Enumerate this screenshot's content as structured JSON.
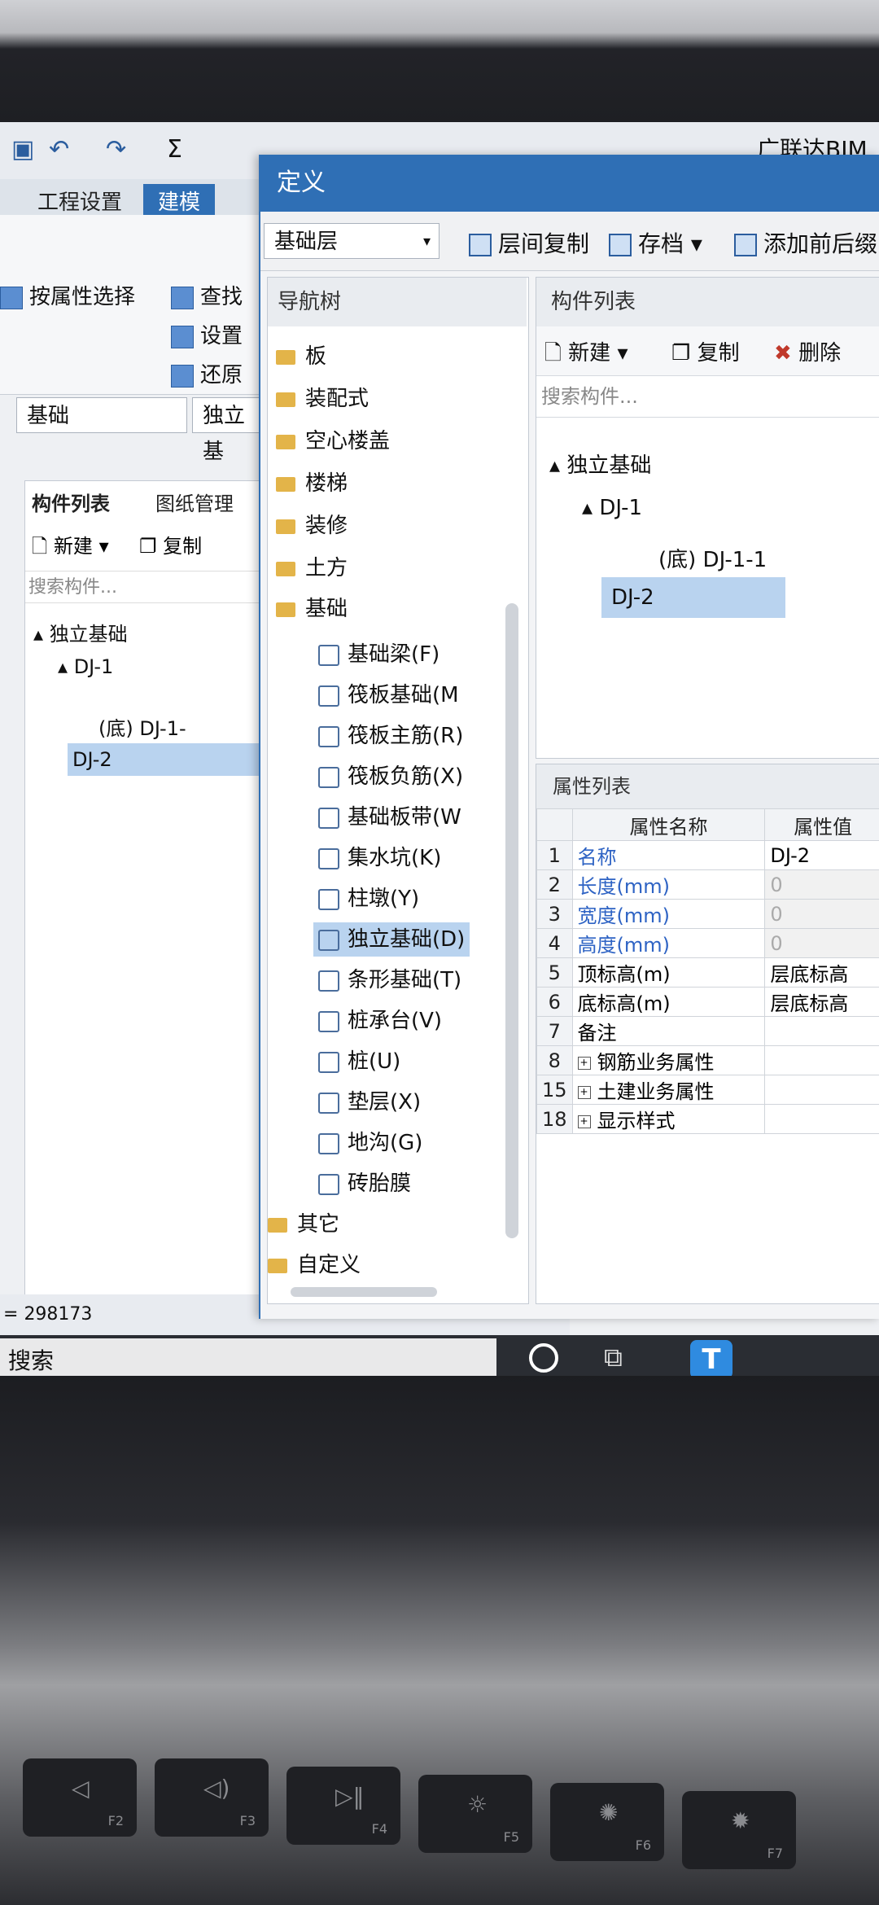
{
  "app": {
    "toolbar": {
      "title_partial": "广联达BIM"
    },
    "ribbon_tabs": [
      {
        "label": "工程设置"
      },
      {
        "label": "建模"
      }
    ],
    "ribbon": {
      "select_by_attr": "按属性选择",
      "find": "查找",
      "set": "设置",
      "restore": "还原"
    },
    "combo_floor": "基础",
    "combo_type": "独立基",
    "left_panel": {
      "tabs": [
        {
          "label": "构件列表"
        },
        {
          "label": "图纸管理"
        }
      ],
      "new_label": "新建",
      "copy_label": "复制",
      "search_placeholder": "搜索构件...",
      "tree": [
        {
          "label": "独立基础"
        },
        {
          "label": "DJ-1"
        },
        {
          "label": "(底) DJ-1-"
        },
        {
          "label": "DJ-2"
        }
      ]
    },
    "status_number": "298173",
    "taskbar": {
      "search_label": "搜索"
    }
  },
  "dialog": {
    "title": "定义",
    "floor_select": "基础层",
    "tools": {
      "copy_between_floors": "层间复制",
      "archive": "存档",
      "add_before": "添加前后缀"
    },
    "nav": {
      "header": "导航树",
      "folders": [
        {
          "label": "板"
        },
        {
          "label": "装配式"
        },
        {
          "label": "空心楼盖"
        },
        {
          "label": "楼梯"
        },
        {
          "label": "装修"
        },
        {
          "label": "土方"
        },
        {
          "label": "基础"
        }
      ],
      "children": [
        {
          "label": "基础梁(F)",
          "icon": "beam-icon"
        },
        {
          "label": "筏板基础(M",
          "icon": "raft-icon"
        },
        {
          "label": "筏板主筋(R)",
          "icon": "main-rebar-icon"
        },
        {
          "label": "筏板负筋(X)",
          "icon": "neg-rebar-icon"
        },
        {
          "label": "基础板带(W",
          "icon": "strip-icon"
        },
        {
          "label": "集水坑(K)",
          "icon": "sump-icon"
        },
        {
          "label": "柱墩(Y)",
          "icon": "pier-icon"
        },
        {
          "label": "独立基础(D)",
          "icon": "isolated-footing-icon"
        },
        {
          "label": "条形基础(T)",
          "icon": "strip-footing-icon"
        },
        {
          "label": "桩承台(V)",
          "icon": "pile-cap-icon"
        },
        {
          "label": "桩(U)",
          "icon": "pile-icon"
        },
        {
          "label": "垫层(X)",
          "icon": "cushion-icon"
        },
        {
          "label": "地沟(G)",
          "icon": "trench-icon"
        },
        {
          "label": "砖胎膜",
          "icon": "brick-mold-icon"
        }
      ],
      "tail_folders": [
        {
          "label": "其它"
        },
        {
          "label": "自定义"
        }
      ]
    },
    "component_list": {
      "header": "构件列表",
      "new_label": "新建",
      "copy_label": "复制",
      "delete_label": "删除",
      "search_placeholder": "搜索构件...",
      "tree": [
        {
          "label": "独立基础"
        },
        {
          "label": "DJ-1"
        },
        {
          "label": "(底) DJ-1-1"
        },
        {
          "label": "DJ-2"
        }
      ]
    },
    "properties": {
      "header": "属性列表",
      "col_name": "属性名称",
      "col_value": "属性值",
      "rows": [
        {
          "num": "1",
          "name": "名称",
          "value": "DJ-2"
        },
        {
          "num": "2",
          "name": "长度(mm)",
          "value": "0"
        },
        {
          "num": "3",
          "name": "宽度(mm)",
          "value": "0"
        },
        {
          "num": "4",
          "name": "高度(mm)",
          "value": "0"
        },
        {
          "num": "5",
          "name": "顶标高(m)",
          "value": "层底标高"
        },
        {
          "num": "6",
          "name": "底标高(m)",
          "value": "层底标高"
        },
        {
          "num": "7",
          "name": "备注",
          "value": ""
        },
        {
          "num": "8",
          "name": "钢筋业务属性",
          "value": ""
        },
        {
          "num": "15",
          "name": "土建业务属性",
          "value": ""
        },
        {
          "num": "18",
          "name": "显示样式",
          "value": ""
        }
      ]
    }
  },
  "keyboard": {
    "keys": [
      {
        "label": "F2"
      },
      {
        "label": "F3"
      },
      {
        "label": "F4"
      },
      {
        "label": "F5"
      },
      {
        "label": "F6"
      },
      {
        "label": "F7"
      }
    ]
  }
}
